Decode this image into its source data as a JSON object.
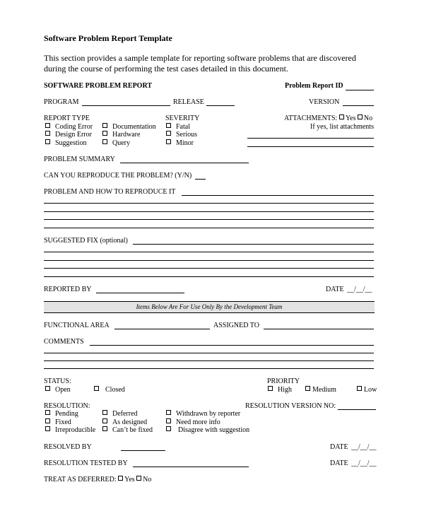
{
  "document": {
    "title": "Software Problem Report Template",
    "intro_line1": "This section provides a sample template for reporting software problems that are discovered",
    "intro_line2": "during the course of performing the test cases detailed in this document."
  },
  "form": {
    "heading": "SOFTWARE PROBLEM REPORT",
    "problem_report_id_label": "Problem Report ID",
    "program_label": "PROGRAM",
    "release_label": "RELEASE",
    "version_label": "VERSION",
    "report_type": {
      "label": "REPORT TYPE",
      "options": [
        "Coding Error",
        "Design Error",
        "Suggestion",
        "Documentation",
        "Hardware",
        "Query"
      ]
    },
    "severity": {
      "label": "SEVERITY",
      "options": [
        "Fatal",
        "Serious",
        "Minor"
      ]
    },
    "attachments": {
      "label": "ATTACHMENTS:",
      "yes": "Yes",
      "no": "No",
      "note": "If yes, list attachments"
    },
    "problem_summary_label": "PROBLEM SUMMARY",
    "reproduce_label": "CAN YOU REPRODUCE THE PROBLEM? (Y/N)",
    "problem_how_label": "PROBLEM AND HOW TO REPRODUCE IT",
    "suggested_fix_label": "SUGGESTED FIX (optional)",
    "reported_by_label": "REPORTED BY",
    "date_label": "DATE",
    "date_placeholder": "__/__/__",
    "dev_band": "Items Below Are For Use Only By the Development Team",
    "functional_area_label": "FUNCTIONAL AREA",
    "assigned_to_label": "ASSIGNED TO",
    "comments_label": "COMMENTS",
    "status": {
      "label": "STATUS:",
      "options": [
        "Open",
        "Closed"
      ]
    },
    "priority": {
      "label": "PRIORITY",
      "options": [
        "High",
        "Medium",
        "Low"
      ]
    },
    "resolution": {
      "label": "RESOLUTION:",
      "options": [
        "Pending",
        "Fixed",
        "Irreproducible",
        "Deferred",
        "As designed",
        "Can’t be fixed",
        "Withdrawn by reporter",
        "Need more info",
        "Disagree with suggestion"
      ]
    },
    "resolution_version_label": "RESOLUTION VERSION NO:",
    "resolved_by_label": "RESOLVED BY",
    "resolution_tested_by_label": "RESOLUTION TESTED BY",
    "treat_deferred": {
      "label": "TREAT AS DEFERRED:",
      "yes": "Yes",
      "no": "No"
    }
  }
}
